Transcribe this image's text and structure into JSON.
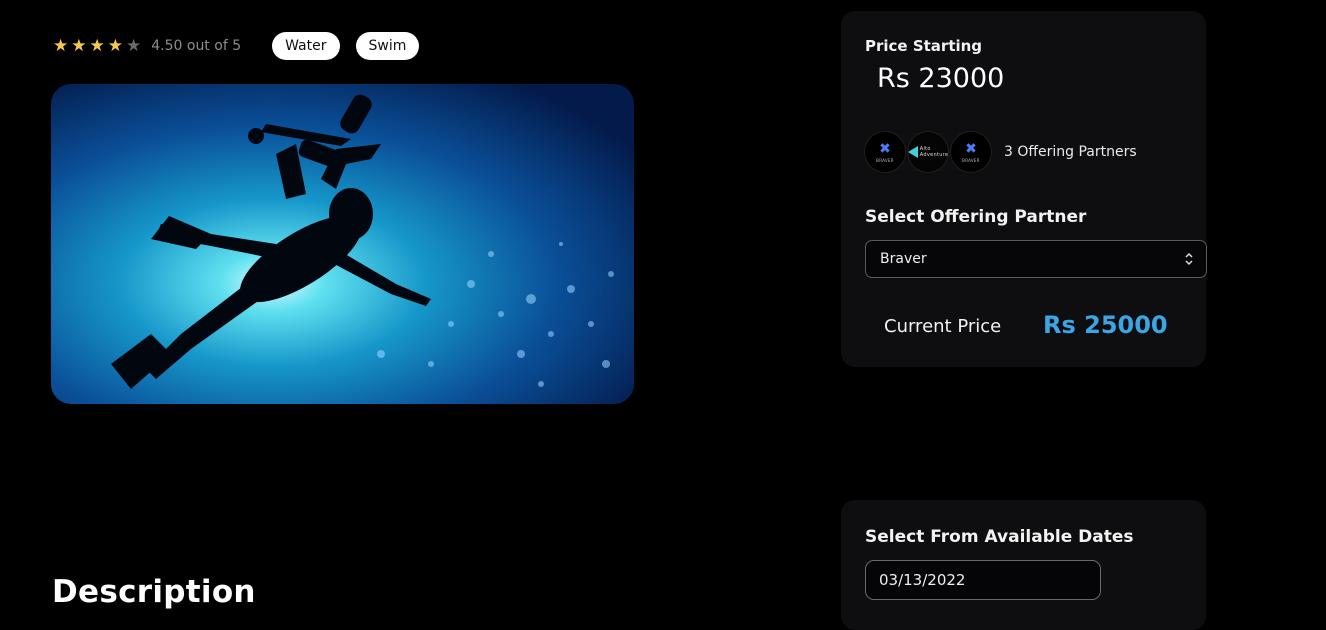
{
  "rating": {
    "value": 4.5,
    "max": 5,
    "text": "4.50 out of 5"
  },
  "tags": [
    "Water",
    "Swim"
  ],
  "hero": {
    "icon": "scuba-diver-image"
  },
  "description": {
    "title": "Description"
  },
  "pricing": {
    "starting_label": "Price Starting",
    "starting_value": "Rs 23000",
    "partners_text": "3 Offering Partners",
    "partner_logos": [
      "BRAVER",
      "Alto Adventure",
      "BRAVER"
    ],
    "select_label": "Select Offering Partner",
    "selected_partner": "Braver",
    "current_label": "Current Price",
    "current_value": "Rs 25000",
    "accent_color": "#3aa6e6"
  },
  "dates": {
    "label": "Select From Available Dates",
    "value": "03/13/2022"
  }
}
